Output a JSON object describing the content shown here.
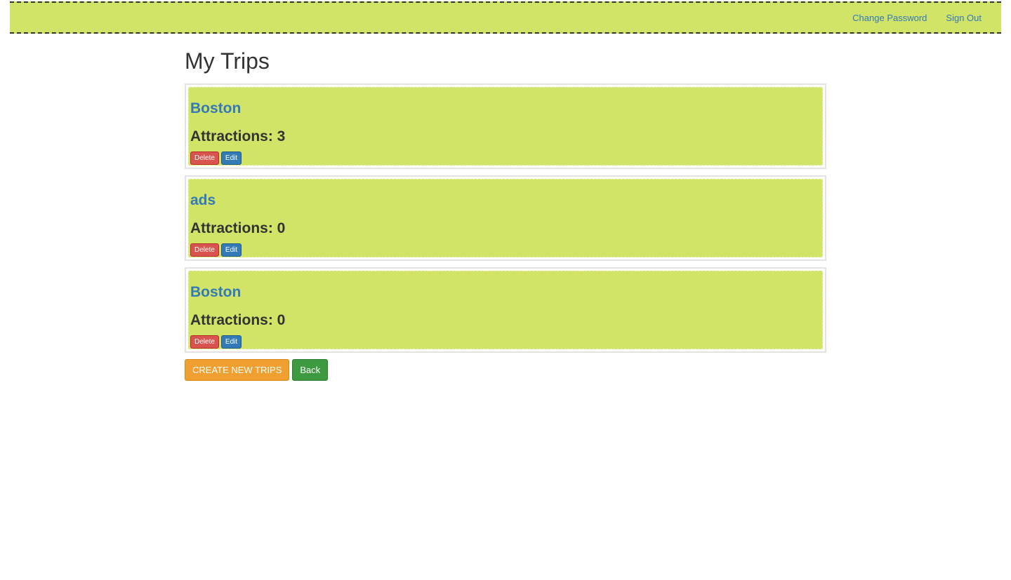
{
  "nav": {
    "change_password": "Change Password",
    "sign_out": "Sign Out"
  },
  "page": {
    "title": "My Trips"
  },
  "trips": [
    {
      "name": "Boston",
      "attractions": "Attractions: 3",
      "delete": "Delete",
      "edit": "Edit"
    },
    {
      "name": "ads",
      "attractions": "Attractions: 0",
      "delete": "Delete",
      "edit": "Edit"
    },
    {
      "name": "Boston",
      "attractions": "Attractions: 0",
      "delete": "Delete",
      "edit": "Edit"
    }
  ],
  "actions": {
    "create": "CREATE NEW TRIPS",
    "back": "Back"
  },
  "colors": {
    "accent": "#d1e467",
    "link": "#337ab7",
    "danger": "#d9534f",
    "primary": "#337ab7",
    "warning": "#f0a030",
    "success": "#3d9a41"
  }
}
